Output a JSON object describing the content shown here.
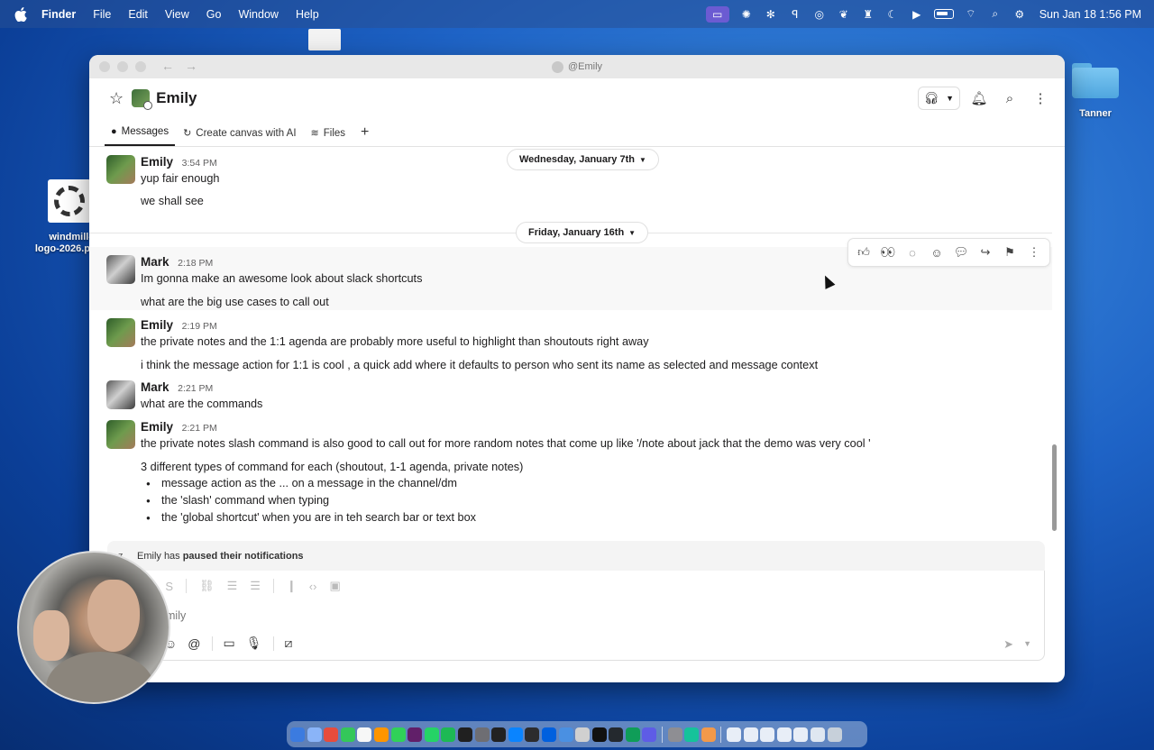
{
  "menubar": {
    "app": "Finder",
    "items": [
      "File",
      "Edit",
      "View",
      "Go",
      "Window",
      "Help"
    ],
    "clock": "Sun Jan 18  1:56 PM",
    "status_icons": [
      "screen-share-icon",
      "openai-icon",
      "perplexity-icon",
      "grammarly-icon",
      "copilot-icon",
      "feather-icon",
      "run-icon",
      "moon-icon",
      "play-icon",
      "battery-icon",
      "wifi-icon",
      "spotlight-icon",
      "control-center-icon"
    ]
  },
  "desktop": {
    "folder_label": "Tanner",
    "file_label_line1": "windmill-",
    "file_label_line2": "logo-2026.p"
  },
  "window": {
    "title": "@Emily",
    "channel_name": "Emily",
    "tabs": [
      {
        "label": "Messages",
        "icon": "message-icon"
      },
      {
        "label": "Create canvas with AI",
        "icon": "canvas-icon"
      },
      {
        "label": "Files",
        "icon": "files-icon"
      }
    ]
  },
  "dividers": {
    "first": "Wednesday, January 7th",
    "second": "Friday, January 16th"
  },
  "messages": [
    {
      "author": "Emily",
      "time": "3:54 PM",
      "lines": [
        "yup fair enough",
        "we shall see"
      ]
    },
    {
      "author": "Mark",
      "time": "2:18 PM",
      "lines": [
        "Im gonna make an awesome look about slack shortcuts",
        "what are the big use cases to call out"
      ]
    },
    {
      "author": "Emily",
      "time": "2:19 PM",
      "lines": [
        "the private notes and the 1:1 agenda are probably more useful to highlight than shoutouts right away",
        "i think the message action for 1:1 is cool ,  a quick add where it defaults to person who sent its name as selected and message context"
      ]
    },
    {
      "author": "Mark",
      "time": "2:21 PM",
      "lines": [
        "what are the commands"
      ]
    },
    {
      "author": "Emily",
      "time": "2:21 PM",
      "lines": [
        "the private notes slash command is also good to call out for more random notes that come up like '/note about jack that the demo was very cool '",
        "3 different types of command for each (shoutout, 1-1 agenda, private notes)"
      ],
      "bullets": [
        "message action as the ... on a message in the channel/dm",
        "the 'slash' command when typing",
        "the 'global shortcut' when you are in teh search bar or text box"
      ]
    }
  ],
  "message_actions": [
    "thumbs-up-icon",
    "eyes-icon",
    "loading-icon",
    "add-reaction-icon",
    "reply-thread-icon",
    "forward-icon",
    "bookmark-icon",
    "more-icon"
  ],
  "composer": {
    "notice_prefix": "Emily has",
    "notice_bold": "paused their notifications",
    "placeholder_partial": "mily"
  },
  "colors": {
    "accent": "#1d1c1d",
    "desktop_blue": "#1e63c6"
  }
}
